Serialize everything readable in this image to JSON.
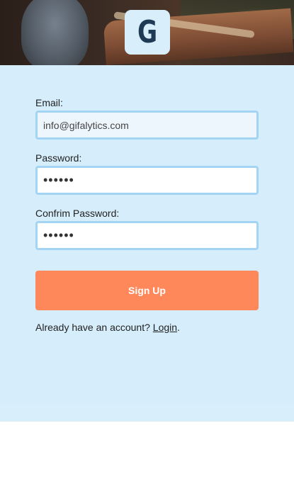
{
  "header": {
    "logo_letter": "G",
    "logo_color": "#1e3a55",
    "logo_tile_color": "#d8eefb"
  },
  "form": {
    "email": {
      "label": "Email:",
      "value": "info@gifalytics.com"
    },
    "password": {
      "label": "Password:",
      "value": "••••••"
    },
    "confirm_password": {
      "label": "Confrim Password:",
      "value": "••••••"
    },
    "submit_label": "Sign Up",
    "submit_color": "#ff885b",
    "account_prompt": "Already have an account?",
    "login_link": "Login",
    "trailing_period": "."
  },
  "theme": {
    "panel_background": "#d6edfb",
    "field_border": "#a4d4f3"
  }
}
